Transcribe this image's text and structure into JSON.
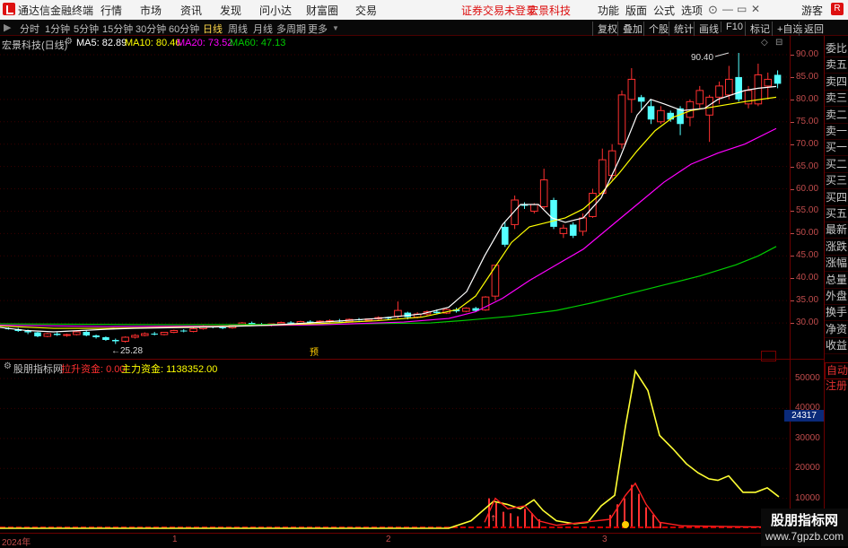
{
  "titlebar": {
    "app_name": "通达信金融终端",
    "menus": [
      "行情",
      "市场",
      "资讯",
      "发现",
      "问小达",
      "财富圈",
      "交易"
    ],
    "warning": "证券交易未登录",
    "stock_name": "宏景科技",
    "tools": [
      "功能",
      "版面",
      "公式",
      "选项"
    ],
    "user": "游客",
    "badge": "R"
  },
  "toolbar": {
    "periods": [
      "分时",
      "1分钟",
      "5分钟",
      "15分钟",
      "30分钟",
      "60分钟",
      "日线",
      "周线",
      "月线",
      "多周期",
      "更多"
    ],
    "active_period": "日线",
    "right_buttons": [
      "复权",
      "叠加",
      "个股",
      "统计",
      "画线",
      "F10",
      "标记",
      "+自选",
      "返回"
    ]
  },
  "main_chart": {
    "info": {
      "stock": "宏景科技(日线)",
      "ma5": "MA5: 82.89",
      "ma10": "MA10: 80.46",
      "ma20": "MA20: 73.52",
      "ma60": "MA60: 47.13"
    },
    "y_ticks": [
      "90.00",
      "85.00",
      "80.00",
      "75.00",
      "70.00",
      "65.00",
      "60.00",
      "55.00",
      "50.00",
      "45.00",
      "40.00",
      "35.00",
      "30.00"
    ],
    "high_label": "90.40",
    "low_label": "25.28",
    "marker": "预",
    "colors": {
      "up": "#ff3030",
      "down": "#54ffff",
      "ma5": "#ffffff",
      "ma10": "#ffff00",
      "ma20": "#ff00ff",
      "ma60": "#00cc00"
    }
  },
  "indicator": {
    "name": "股朋指标网",
    "field1": "拉升资金: 0.00",
    "field2": "主力资金: 1138352.00",
    "y_ticks": [
      "50000",
      "40000",
      "30000",
      "20000",
      "10000"
    ],
    "current": "24317"
  },
  "x_axis": {
    "labels": [
      "2024年",
      "1",
      "2",
      "3"
    ]
  },
  "right_column": [
    "委比",
    "卖五",
    "卖四",
    "卖三",
    "卖二",
    "卖一",
    "买一",
    "买二",
    "买三",
    "买四",
    "买五",
    "最新",
    "涨跌",
    "涨幅",
    "总量",
    "外盘",
    "换手",
    "净资",
    "收益",
    "自动",
    "注册"
  ],
  "watermark": {
    "name": "股朋指标网",
    "url": "www.7gpzb.com"
  },
  "chart_data": {
    "type": "candlestick",
    "ylim": [
      25,
      92
    ],
    "candles": [
      {
        "o": 28.8,
        "h": 29.0,
        "l": 28.5,
        "c": 28.6
      },
      {
        "o": 28.6,
        "h": 28.9,
        "l": 28.0,
        "c": 28.2
      },
      {
        "o": 28.2,
        "h": 28.5,
        "l": 27.5,
        "c": 27.9
      },
      {
        "o": 27.9,
        "h": 28.0,
        "l": 26.8,
        "c": 27.0
      },
      {
        "o": 27.0,
        "h": 27.8,
        "l": 26.8,
        "c": 27.6
      },
      {
        "o": 27.6,
        "h": 27.9,
        "l": 27.1,
        "c": 27.3
      },
      {
        "o": 27.3,
        "h": 27.6,
        "l": 26.9,
        "c": 27.4
      },
      {
        "o": 27.4,
        "h": 28.2,
        "l": 27.2,
        "c": 28.0
      },
      {
        "o": 28.0,
        "h": 28.3,
        "l": 27.0,
        "c": 27.2
      },
      {
        "o": 27.2,
        "h": 27.4,
        "l": 26.5,
        "c": 26.8
      },
      {
        "o": 26.8,
        "h": 27.0,
        "l": 26.0,
        "c": 26.2
      },
      {
        "o": 26.2,
        "h": 26.5,
        "l": 25.3,
        "c": 25.9
      },
      {
        "o": 25.9,
        "h": 27.0,
        "l": 25.6,
        "c": 26.8
      },
      {
        "o": 26.8,
        "h": 27.5,
        "l": 26.5,
        "c": 27.2
      },
      {
        "o": 27.2,
        "h": 27.9,
        "l": 27.0,
        "c": 27.6
      },
      {
        "o": 27.6,
        "h": 28.0,
        "l": 27.2,
        "c": 27.4
      },
      {
        "o": 27.4,
        "h": 28.0,
        "l": 27.2,
        "c": 27.9
      },
      {
        "o": 27.9,
        "h": 28.5,
        "l": 27.7,
        "c": 28.3
      },
      {
        "o": 28.3,
        "h": 28.6,
        "l": 27.9,
        "c": 28.1
      },
      {
        "o": 28.1,
        "h": 28.9,
        "l": 27.9,
        "c": 28.7
      },
      {
        "o": 28.7,
        "h": 29.5,
        "l": 28.5,
        "c": 29.3
      },
      {
        "o": 29.3,
        "h": 29.4,
        "l": 28.8,
        "c": 29.0
      },
      {
        "o": 29.0,
        "h": 29.3,
        "l": 28.6,
        "c": 28.9
      },
      {
        "o": 28.9,
        "h": 29.6,
        "l": 28.7,
        "c": 29.4
      },
      {
        "o": 29.4,
        "h": 30.2,
        "l": 29.2,
        "c": 30.0
      },
      {
        "o": 30.0,
        "h": 30.3,
        "l": 29.5,
        "c": 29.7
      },
      {
        "o": 29.7,
        "h": 30.0,
        "l": 29.3,
        "c": 29.5
      },
      {
        "o": 29.5,
        "h": 29.9,
        "l": 29.2,
        "c": 29.8
      },
      {
        "o": 29.8,
        "h": 30.3,
        "l": 29.6,
        "c": 30.1
      },
      {
        "o": 30.1,
        "h": 30.4,
        "l": 29.8,
        "c": 29.9
      },
      {
        "o": 29.9,
        "h": 30.5,
        "l": 29.7,
        "c": 30.3
      },
      {
        "o": 30.3,
        "h": 30.6,
        "l": 30.0,
        "c": 30.2
      },
      {
        "o": 30.2,
        "h": 30.6,
        "l": 30.0,
        "c": 30.4
      },
      {
        "o": 30.4,
        "h": 30.8,
        "l": 30.1,
        "c": 30.5
      },
      {
        "o": 30.5,
        "h": 30.9,
        "l": 30.2,
        "c": 30.3
      },
      {
        "o": 30.3,
        "h": 31.0,
        "l": 30.1,
        "c": 30.8
      },
      {
        "o": 30.8,
        "h": 31.1,
        "l": 30.5,
        "c": 30.6
      },
      {
        "o": 30.6,
        "h": 31.0,
        "l": 30.4,
        "c": 30.9
      },
      {
        "o": 30.9,
        "h": 31.5,
        "l": 30.7,
        "c": 31.2
      },
      {
        "o": 31.2,
        "h": 31.4,
        "l": 30.8,
        "c": 31.0
      },
      {
        "o": 31.5,
        "h": 34.8,
        "l": 31.0,
        "c": 32.8
      },
      {
        "o": 32.3,
        "h": 32.5,
        "l": 30.8,
        "c": 31.3
      },
      {
        "o": 31.3,
        "h": 32.4,
        "l": 31.0,
        "c": 32.0
      },
      {
        "o": 32.0,
        "h": 32.8,
        "l": 31.7,
        "c": 32.5
      },
      {
        "o": 32.5,
        "h": 33.0,
        "l": 31.9,
        "c": 32.2
      },
      {
        "o": 32.2,
        "h": 33.2,
        "l": 32.0,
        "c": 33.0
      },
      {
        "o": 33.0,
        "h": 33.4,
        "l": 32.3,
        "c": 32.6
      },
      {
        "o": 32.6,
        "h": 33.5,
        "l": 32.4,
        "c": 33.3
      },
      {
        "o": 33.3,
        "h": 33.6,
        "l": 32.5,
        "c": 32.7
      },
      {
        "o": 32.9,
        "h": 36.0,
        "l": 32.7,
        "c": 35.8
      },
      {
        "o": 36.0,
        "h": 43.0,
        "l": 35.0,
        "c": 42.9
      },
      {
        "o": 51.5,
        "h": 52.5,
        "l": 47.0,
        "c": 47.5
      },
      {
        "o": 52.0,
        "h": 58.5,
        "l": 51.0,
        "c": 57.5
      },
      {
        "o": 56.5,
        "h": 57.0,
        "l": 55.5,
        "c": 56.2
      },
      {
        "o": 55.0,
        "h": 56.8,
        "l": 54.5,
        "c": 56.5
      },
      {
        "o": 56.0,
        "h": 64.5,
        "l": 55.5,
        "c": 62.0
      },
      {
        "o": 57.5,
        "h": 58.0,
        "l": 51.0,
        "c": 51.5
      },
      {
        "o": 50.0,
        "h": 52.0,
        "l": 49.0,
        "c": 51.2
      },
      {
        "o": 52.0,
        "h": 52.5,
        "l": 49.0,
        "c": 49.5
      },
      {
        "o": 50.5,
        "h": 54.5,
        "l": 49.5,
        "c": 53.5
      },
      {
        "o": 53.8,
        "h": 60.0,
        "l": 53.5,
        "c": 59.0
      },
      {
        "o": 59.0,
        "h": 69.0,
        "l": 58.5,
        "c": 66.5
      },
      {
        "o": 63.0,
        "h": 70.0,
        "l": 62.0,
        "c": 68.5
      },
      {
        "o": 70.0,
        "h": 82.0,
        "l": 69.0,
        "c": 81.0
      },
      {
        "o": 80.0,
        "h": 87.0,
        "l": 77.0,
        "c": 84.5
      },
      {
        "o": 80.5,
        "h": 81.0,
        "l": 77.5,
        "c": 79.5
      },
      {
        "o": 78.5,
        "h": 80.0,
        "l": 74.5,
        "c": 75.5
      },
      {
        "o": 75.0,
        "h": 78.5,
        "l": 74.5,
        "c": 77.5
      },
      {
        "o": 77.0,
        "h": 77.5,
        "l": 75.0,
        "c": 75.5
      },
      {
        "o": 78.0,
        "h": 78.5,
        "l": 72.0,
        "c": 74.5
      },
      {
        "o": 76.0,
        "h": 80.0,
        "l": 74.0,
        "c": 79.5
      },
      {
        "o": 79.0,
        "h": 83.0,
        "l": 78.0,
        "c": 82.0
      },
      {
        "o": 76.5,
        "h": 81.0,
        "l": 70.5,
        "c": 80.5
      },
      {
        "o": 80.5,
        "h": 84.0,
        "l": 79.0,
        "c": 83.0
      },
      {
        "o": 81.0,
        "h": 87.5,
        "l": 80.0,
        "c": 84.5
      },
      {
        "o": 85.0,
        "h": 90.4,
        "l": 79.5,
        "c": 80.0
      },
      {
        "o": 79.0,
        "h": 83.0,
        "l": 78.0,
        "c": 82.0
      },
      {
        "o": 79.0,
        "h": 88.0,
        "l": 78.5,
        "c": 85.5
      },
      {
        "o": 83.0,
        "h": 86.0,
        "l": 80.0,
        "c": 84.5
      },
      {
        "o": 85.5,
        "h": 86.5,
        "l": 82.5,
        "c": 83.5
      }
    ],
    "ma5": [
      [
        0,
        29.0
      ],
      [
        30,
        28.3
      ],
      [
        60,
        28.0
      ],
      [
        90,
        28.3
      ],
      [
        120,
        28.6
      ],
      [
        150,
        28.8
      ],
      [
        180,
        28.9
      ],
      [
        240,
        29.1
      ],
      [
        300,
        29.5
      ],
      [
        360,
        30.2
      ],
      [
        420,
        31.0
      ],
      [
        470,
        32.0
      ],
      [
        500,
        33.5
      ],
      [
        520,
        37.0
      ],
      [
        540,
        45.0
      ],
      [
        560,
        52.0
      ],
      [
        580,
        56.5
      ],
      [
        600,
        56.5
      ],
      [
        615,
        53.5
      ],
      [
        630,
        52.5
      ],
      [
        650,
        53.5
      ],
      [
        670,
        58.0
      ],
      [
        690,
        66.5
      ],
      [
        710,
        76.5
      ],
      [
        725,
        80.0
      ],
      [
        740,
        79.0
      ],
      [
        760,
        77.5
      ],
      [
        785,
        78.0
      ],
      [
        800,
        80.0
      ],
      [
        830,
        82.0
      ],
      [
        845,
        82.5
      ],
      [
        865,
        82.9
      ]
    ],
    "ma10": [
      [
        0,
        29.3
      ],
      [
        60,
        28.8
      ],
      [
        120,
        28.8
      ],
      [
        180,
        29.0
      ],
      [
        240,
        29.2
      ],
      [
        300,
        29.5
      ],
      [
        360,
        29.9
      ],
      [
        420,
        30.5
      ],
      [
        470,
        31.3
      ],
      [
        510,
        33.0
      ],
      [
        530,
        36.0
      ],
      [
        550,
        42.0
      ],
      [
        570,
        48.0
      ],
      [
        590,
        51.5
      ],
      [
        610,
        52.5
      ],
      [
        630,
        53.5
      ],
      [
        650,
        55.5
      ],
      [
        670,
        59.0
      ],
      [
        690,
        63.5
      ],
      [
        710,
        68.5
      ],
      [
        730,
        73.0
      ],
      [
        750,
        76.0
      ],
      [
        770,
        77.5
      ],
      [
        800,
        78.5
      ],
      [
        830,
        79.5
      ],
      [
        865,
        80.5
      ]
    ],
    "ma20": [
      [
        0,
        29.5
      ],
      [
        120,
        29.2
      ],
      [
        240,
        29.3
      ],
      [
        360,
        29.6
      ],
      [
        450,
        30.2
      ],
      [
        500,
        31.0
      ],
      [
        530,
        32.5
      ],
      [
        560,
        35.5
      ],
      [
        590,
        39.5
      ],
      [
        620,
        43.0
      ],
      [
        650,
        46.5
      ],
      [
        680,
        51.5
      ],
      [
        710,
        56.5
      ],
      [
        740,
        61.5
      ],
      [
        770,
        65.5
      ],
      [
        800,
        68.0
      ],
      [
        830,
        70.0
      ],
      [
        865,
        73.5
      ]
    ],
    "ma60": [
      [
        0,
        29.8
      ],
      [
        200,
        29.6
      ],
      [
        350,
        29.7
      ],
      [
        480,
        30.0
      ],
      [
        520,
        30.6
      ],
      [
        570,
        31.5
      ],
      [
        620,
        32.8
      ],
      [
        660,
        34.5
      ],
      [
        700,
        36.5
      ],
      [
        740,
        38.5
      ],
      [
        780,
        40.5
      ],
      [
        820,
        43.0
      ],
      [
        845,
        45.0
      ],
      [
        865,
        47.1
      ]
    ],
    "indicator_series": {
      "line": [
        [
          0,
          0
        ],
        [
          500,
          0
        ],
        [
          525,
          2500
        ],
        [
          550,
          9000
        ],
        [
          565,
          8000
        ],
        [
          580,
          6500
        ],
        [
          595,
          9500
        ],
        [
          605,
          6000
        ],
        [
          620,
          2500
        ],
        [
          640,
          1500
        ],
        [
          655,
          2000
        ],
        [
          670,
          7500
        ],
        [
          685,
          11000
        ],
        [
          697,
          34000
        ],
        [
          708,
          52500
        ],
        [
          722,
          46000
        ],
        [
          735,
          31000
        ],
        [
          750,
          26500
        ],
        [
          765,
          21500
        ],
        [
          778,
          18500
        ],
        [
          790,
          16500
        ],
        [
          800,
          16000
        ],
        [
          812,
          17500
        ],
        [
          828,
          12000
        ],
        [
          842,
          12000
        ],
        [
          855,
          13500
        ],
        [
          868,
          10500
        ]
      ],
      "fund_bars": [
        [
          545,
          10000
        ],
        [
          553,
          8500
        ],
        [
          561,
          5500
        ],
        [
          569,
          5000
        ],
        [
          577,
          4000
        ],
        [
          585,
          6500
        ],
        [
          593,
          5000
        ],
        [
          601,
          3000
        ],
        [
          680,
          4500
        ],
        [
          688,
          8000
        ],
        [
          696,
          10000
        ],
        [
          704,
          14500
        ],
        [
          712,
          11500
        ],
        [
          720,
          7000
        ],
        [
          728,
          4500
        ],
        [
          736,
          2000
        ]
      ],
      "ylim": [
        0,
        56000
      ]
    }
  }
}
